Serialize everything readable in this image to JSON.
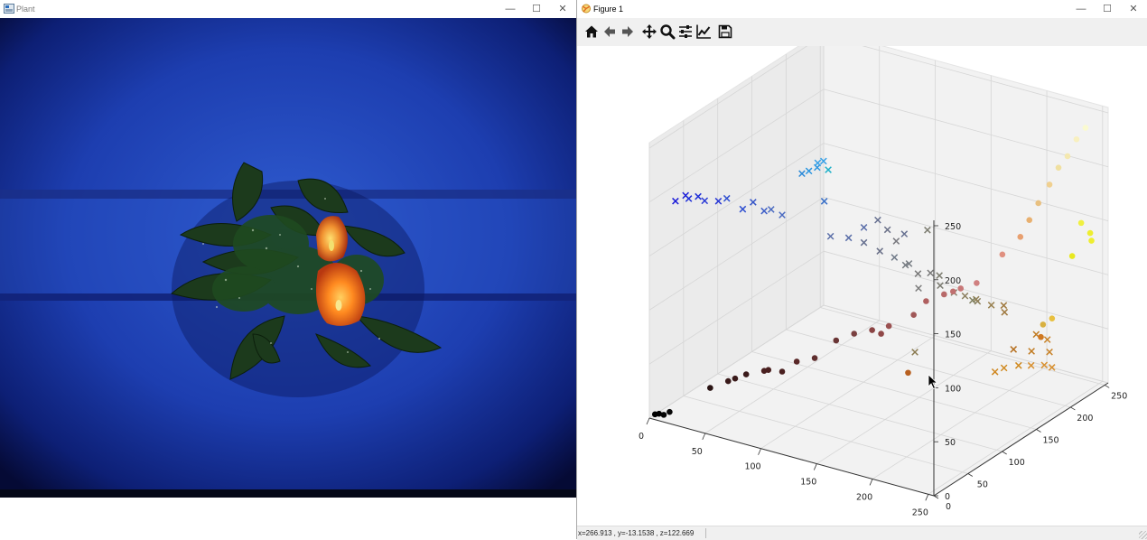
{
  "plant_window": {
    "title": "Plant",
    "controls": {
      "minimize": "—",
      "maximize": "☐",
      "close": "✕"
    }
  },
  "figure_window": {
    "title": "Figure 1",
    "controls": {
      "minimize": "—",
      "maximize": "☐",
      "close": "✕"
    },
    "toolbar": [
      "home-icon",
      "back-arrow-icon",
      "forward-arrow-icon",
      "pan-move-icon",
      "zoom-magnifier-icon",
      "configure-subplots-icon",
      "edit-axis-icon",
      "save-floppy-icon"
    ],
    "status": {
      "x": "x=266.913",
      "y": ", y=-13.1538",
      "z": ", z=122.669"
    }
  },
  "chart_data": {
    "type": "scatter3d",
    "title": "",
    "xlabel": "",
    "ylabel": "",
    "zlabel": "",
    "xlim": [
      0,
      255
    ],
    "ylim": [
      0,
      255
    ],
    "zlim": [
      0,
      255
    ],
    "x_ticks": [
      "0",
      "50",
      "100",
      "150",
      "200",
      "250"
    ],
    "y_ticks": [
      "0",
      "50",
      "100",
      "150",
      "200",
      "250"
    ],
    "z_ticks": [
      "0",
      "50",
      "100",
      "150",
      "200",
      "250"
    ],
    "grid": true,
    "series": [
      {
        "marker": "x",
        "points": [
          [
            5,
            30,
            190,
            "#1a1ad8"
          ],
          [
            8,
            40,
            192,
            "#1a1ad8"
          ],
          [
            12,
            38,
            191,
            "#1f2fd8"
          ],
          [
            18,
            42,
            193,
            "#1f2fd8"
          ],
          [
            22,
            45,
            189,
            "#2838d5"
          ],
          [
            30,
            52,
            188,
            "#2838d5"
          ],
          [
            40,
            48,
            195,
            "#3050d0"
          ],
          [
            50,
            55,
            185,
            "#3050d0"
          ],
          [
            55,
            62,
            190,
            "#3555c8"
          ],
          [
            60,
            70,
            180,
            "#3f5fc8"
          ],
          [
            70,
            80,
            175,
            "#4a6ac0"
          ],
          [
            65,
            72,
            182,
            "#4a6ac0"
          ],
          [
            100,
            60,
            230,
            "#2c8ad8"
          ],
          [
            105,
            62,
            233,
            "#2c96e0"
          ],
          [
            110,
            66,
            236,
            "#2c96e0"
          ],
          [
            112,
            72,
            240,
            "#35a0e8"
          ],
          [
            108,
            70,
            238,
            "#35a0e8"
          ],
          [
            115,
            74,
            232,
            "#20b0c8"
          ],
          [
            120,
            60,
            210,
            "#3a70c8"
          ],
          [
            95,
            110,
            150,
            "#5a6ea8"
          ],
          [
            110,
            112,
            152,
            "#5a6ea8"
          ],
          [
            120,
            118,
            148,
            "#667090"
          ],
          [
            130,
            125,
            140,
            "#6a7088"
          ],
          [
            140,
            130,
            135,
            "#707a88"
          ],
          [
            150,
            135,
            130,
            "#747a80"
          ],
          [
            145,
            138,
            126,
            "#747a80"
          ],
          [
            155,
            140,
            120,
            "#787878"
          ],
          [
            160,
            150,
            118,
            "#787878"
          ],
          [
            170,
            148,
            110,
            "#7a7a70"
          ],
          [
            165,
            155,
            115,
            "#7c7c70"
          ],
          [
            175,
            160,
            100,
            "#86806a"
          ],
          [
            180,
            168,
            95,
            "#8c8060"
          ],
          [
            190,
            170,
            92,
            "#8c8060"
          ],
          [
            185,
            176,
            90,
            "#928056"
          ],
          [
            195,
            182,
            85,
            "#988050"
          ],
          [
            205,
            185,
            80,
            "#a07a40"
          ],
          [
            200,
            192,
            82,
            "#a07a40"
          ],
          [
            180,
            100,
            130,
            "#7c7c7c"
          ],
          [
            210,
            130,
            115,
            "#808060"
          ],
          [
            140,
            160,
            35,
            "#8a7a50"
          ],
          [
            120,
            118,
            162,
            "#5a6ea8"
          ],
          [
            130,
            122,
            170,
            "#667090"
          ],
          [
            135,
            128,
            160,
            "#6a7088"
          ],
          [
            150,
            162,
            150,
            "#7c7c70"
          ],
          [
            155,
            120,
            165,
            "#667090"
          ],
          [
            160,
            100,
            168,
            "#7a7a80"
          ],
          [
            210,
            190,
            45,
            "#b67020"
          ],
          [
            220,
            200,
            42,
            "#c07a20"
          ],
          [
            230,
            210,
            40,
            "#c88228"
          ],
          [
            225,
            215,
            48,
            "#c88228"
          ],
          [
            215,
            215,
            50,
            "#c07a20"
          ],
          [
            180,
            225,
            5,
            "#d08a20"
          ],
          [
            190,
            230,
            8,
            "#d08a20"
          ],
          [
            200,
            232,
            10,
            "#d89030"
          ],
          [
            210,
            235,
            12,
            "#d89030"
          ],
          [
            215,
            238,
            10,
            "#d89030"
          ],
          [
            175,
            220,
            2,
            "#cf8720"
          ]
        ]
      },
      {
        "marker": "o",
        "points": [
          [
            2,
            5,
            2,
            "#000000"
          ],
          [
            5,
            6,
            3,
            "#000000"
          ],
          [
            8,
            8,
            2,
            "#050505"
          ],
          [
            12,
            10,
            5,
            "#0a0a0a"
          ],
          [
            30,
            40,
            20,
            "#2a1414"
          ],
          [
            40,
            50,
            25,
            "#3a1a1a"
          ],
          [
            45,
            52,
            28,
            "#3a1a1a"
          ],
          [
            50,
            60,
            30,
            "#3a1a1a"
          ],
          [
            60,
            70,
            32,
            "#4a2020"
          ],
          [
            65,
            68,
            35,
            "#4a2020"
          ],
          [
            70,
            80,
            30,
            "#4a2020"
          ],
          [
            80,
            85,
            40,
            "#5a2828"
          ],
          [
            90,
            95,
            42,
            "#603030"
          ],
          [
            100,
            110,
            55,
            "#6a3535"
          ],
          [
            110,
            120,
            60,
            "#7a4040"
          ],
          [
            120,
            130,
            62,
            "#8a4444"
          ],
          [
            125,
            135,
            58,
            "#904848"
          ],
          [
            135,
            130,
            70,
            "#9a5050"
          ],
          [
            145,
            150,
            75,
            "#a05858"
          ],
          [
            150,
            160,
            85,
            "#b06060"
          ],
          [
            160,
            170,
            90,
            "#b86a6a"
          ],
          [
            165,
            175,
            92,
            "#c07070"
          ],
          [
            170,
            178,
            95,
            "#c87878"
          ],
          [
            180,
            185,
            100,
            "#d08080"
          ],
          [
            200,
            190,
            130,
            "#e09080"
          ],
          [
            210,
            200,
            145,
            "#e8a070"
          ],
          [
            215,
            205,
            160,
            "#e8b070"
          ],
          [
            220,
            210,
            175,
            "#e8c080"
          ],
          [
            230,
            210,
            195,
            "#f0d090"
          ],
          [
            235,
            215,
            210,
            "#f0e0a0"
          ],
          [
            240,
            220,
            220,
            "#f4e8b0"
          ],
          [
            245,
            225,
            235,
            "#f8f0c0"
          ],
          [
            250,
            230,
            245,
            "#fafad0"
          ],
          [
            240,
            240,
            150,
            "#f0f040"
          ],
          [
            245,
            245,
            140,
            "#eeee30"
          ],
          [
            248,
            242,
            135,
            "#eeee30"
          ],
          [
            235,
            235,
            120,
            "#e8e820"
          ],
          [
            220,
            230,
            60,
            "#e8c040"
          ],
          [
            215,
            225,
            55,
            "#d8b040"
          ],
          [
            210,
            230,
            40,
            "#d07820"
          ],
          [
            140,
            150,
            20,
            "#b86020"
          ]
        ]
      }
    ]
  }
}
